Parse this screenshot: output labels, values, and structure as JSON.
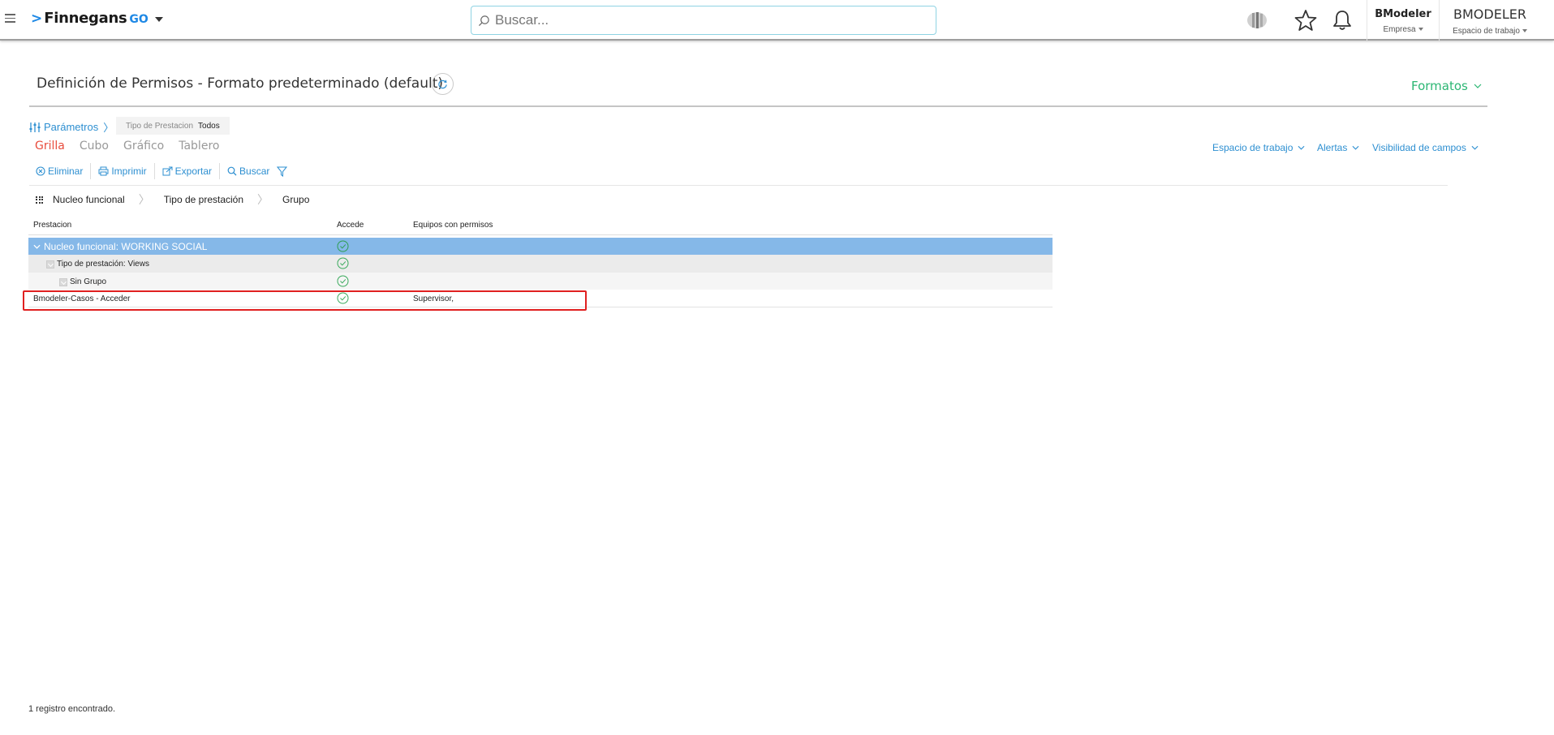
{
  "topbar": {
    "brand": "Finnegans",
    "brand_suffix": "GO",
    "search_placeholder": "Buscar...",
    "company": {
      "name": "BModeler",
      "label": "Empresa"
    },
    "workspace": {
      "name": "BMODELER",
      "label": "Espacio de trabajo"
    }
  },
  "page": {
    "title": "Definición de Permisos - Formato predeterminado (default)",
    "formats_label": "Formatos"
  },
  "params": {
    "label": "Parámetros",
    "chip_key": "Tipo de Prestacion",
    "chip_value": "Todos"
  },
  "views": {
    "grid": "Grilla",
    "cube": "Cubo",
    "chart": "Gráfico",
    "board": "Tablero"
  },
  "right_links": {
    "workspace": "Espacio de trabajo",
    "alerts": "Alertas",
    "field_visibility": "Visibilidad de campos"
  },
  "toolbar": {
    "delete": "Eliminar",
    "print": "Imprimir",
    "export": "Exportar",
    "search": "Buscar"
  },
  "groupby": [
    "Nucleo funcional",
    "Tipo de prestación",
    "Grupo"
  ],
  "grid": {
    "columns": [
      "Prestacion",
      "Accede",
      "Equipos con permisos"
    ],
    "group1": "Nucleo funcional: WORKING SOCIAL",
    "group2": "Tipo de prestación: Views",
    "group3": "Sin Grupo",
    "row": {
      "prestacion": "Bmodeler-Casos - Acceder",
      "equipos": "Supervisor,"
    }
  },
  "footer": {
    "count_text": "1 registro encontrado."
  },
  "colors": {
    "accent_blue": "#2d8fd1",
    "active_tab": "#e84c3d",
    "formats_green": "#2bb673",
    "group_row": "#85b8e8",
    "highlight": "#e02020"
  }
}
